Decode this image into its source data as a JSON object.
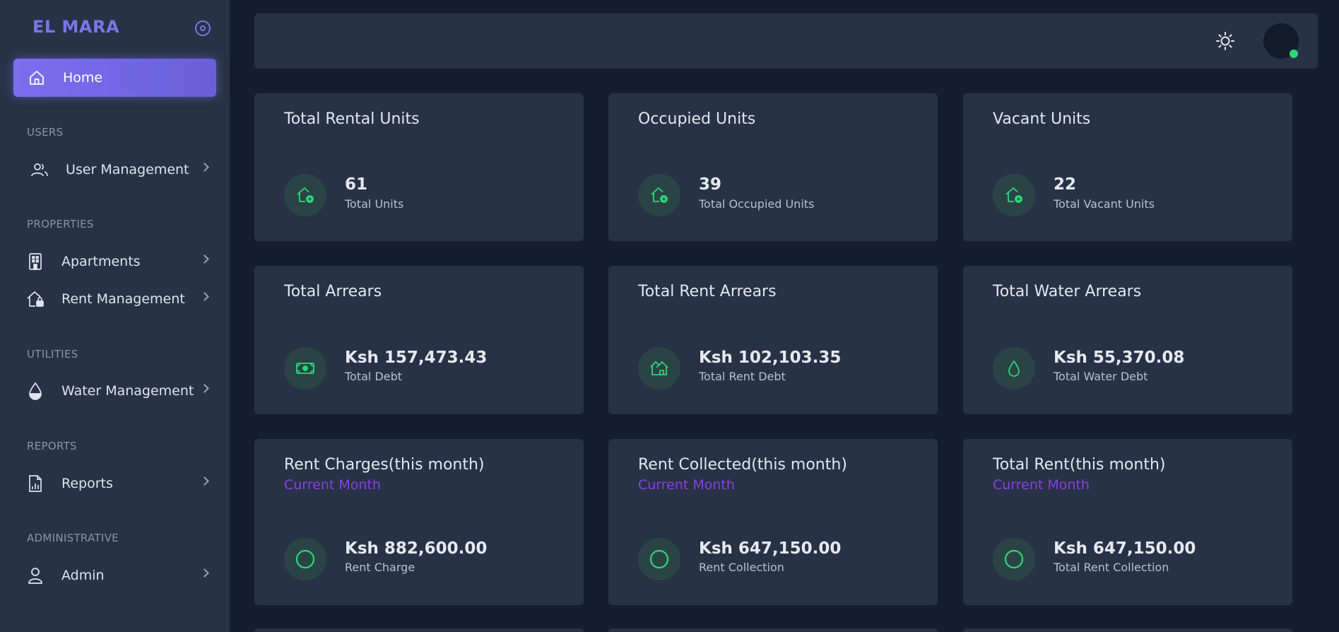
{
  "brand": "EL MARA",
  "nav": {
    "home": "Home",
    "sections": {
      "users": "USERS",
      "properties": "PROPERTIES",
      "utilities": "UTILITIES",
      "reports": "REPORTS",
      "administrative": "ADMINISTRATIVE"
    },
    "items": {
      "user_management": "User Management",
      "apartments": "Apartments",
      "rent_management": "Rent Management",
      "water_management": "Water Management",
      "reports": "Reports",
      "admin": "Admin"
    }
  },
  "colors": {
    "accent": "#7b6ff0",
    "success": "#2fd67a",
    "subtitle": "#8a3fe6"
  },
  "cards": [
    {
      "title": "Total Rental Units",
      "value": "61",
      "caption": "Total Units",
      "icon": "house-plus-icon"
    },
    {
      "title": "Occupied Units",
      "value": "39",
      "caption": "Total Occupied Units",
      "icon": "house-plus-icon"
    },
    {
      "title": "Vacant Units",
      "value": "22",
      "caption": "Total Vacant Units",
      "icon": "house-plus-icon"
    },
    {
      "title": "Total Arrears",
      "value": "Ksh 157,473.43",
      "caption": "Total Debt",
      "icon": "cash-icon"
    },
    {
      "title": "Total Rent Arrears",
      "value": "Ksh 102,103.35",
      "caption": "Total Rent Debt",
      "icon": "houses-icon"
    },
    {
      "title": "Total Water Arrears",
      "value": "Ksh 55,370.08",
      "caption": "Total Water Debt",
      "icon": "water-drop-icon"
    },
    {
      "title": "Rent Charges(this month)",
      "subtitle": "Current Month",
      "value": "Ksh 882,600.00",
      "caption": "Rent Charge",
      "icon": "circle-icon"
    },
    {
      "title": "Rent Collected(this month)",
      "subtitle": "Current Month",
      "value": "Ksh 647,150.00",
      "caption": "Rent Collection",
      "icon": "circle-icon"
    },
    {
      "title": "Total Rent(this month)",
      "subtitle": "Current Month",
      "value": "Ksh 647,150.00",
      "caption": "Total Rent Collection",
      "icon": "circle-icon"
    }
  ]
}
